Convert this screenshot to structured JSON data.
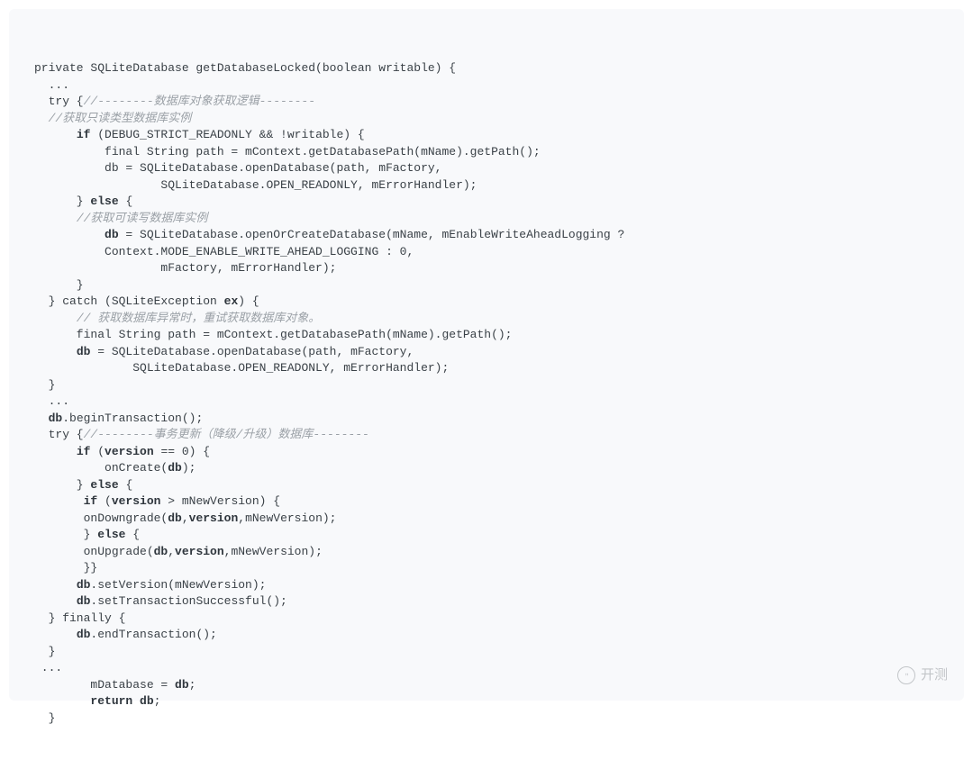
{
  "watermark": {
    "label": "开测"
  },
  "code": {
    "lines": [
      [
        {
          "t": "private SQLiteDatabase getDatabaseLocked(boolean writable) {",
          "c": "id"
        }
      ],
      [
        {
          "t": "  ...",
          "c": "id"
        }
      ],
      [
        {
          "t": "  try {",
          "c": "id"
        },
        {
          "t": "//--------数据库对象获取逻辑--------",
          "c": "cm"
        }
      ],
      [
        {
          "t": "  ",
          "c": "id"
        },
        {
          "t": "//获取只读类型数据库实例",
          "c": "cm"
        }
      ],
      [
        {
          "t": "      ",
          "c": "id"
        },
        {
          "t": "if",
          "c": "kw"
        },
        {
          "t": " (DEBUG_STRICT_READONLY && !writable) {",
          "c": "id"
        }
      ],
      [
        {
          "t": "          final String path = mContext.getDatabasePath(mName).getPath();",
          "c": "id"
        }
      ],
      [
        {
          "t": "          db = SQLiteDatabase.openDatabase(path, mFactory,",
          "c": "id"
        }
      ],
      [
        {
          "t": "                  SQLiteDatabase.OPEN_READONLY, mErrorHandler);",
          "c": "id"
        }
      ],
      [
        {
          "t": "      } ",
          "c": "id"
        },
        {
          "t": "else",
          "c": "kw"
        },
        {
          "t": " {",
          "c": "id"
        }
      ],
      [
        {
          "t": "      ",
          "c": "id"
        },
        {
          "t": "//获取可读写数据库实例",
          "c": "cm"
        }
      ],
      [
        {
          "t": "          ",
          "c": "id"
        },
        {
          "t": "db",
          "c": "kw"
        },
        {
          "t": " = SQLiteDatabase.openOrCreateDatabase(mName, mEnableWriteAheadLogging ?",
          "c": "id"
        }
      ],
      [
        {
          "t": "          Context.MODE_ENABLE_WRITE_AHEAD_LOGGING : 0,",
          "c": "id"
        }
      ],
      [
        {
          "t": "                  mFactory, mErrorHandler);",
          "c": "id"
        }
      ],
      [
        {
          "t": "      }",
          "c": "id"
        }
      ],
      [
        {
          "t": "  } catch (SQLiteException ",
          "c": "id"
        },
        {
          "t": "ex",
          "c": "kw"
        },
        {
          "t": ") {",
          "c": "id"
        }
      ],
      [
        {
          "t": "      ",
          "c": "id"
        },
        {
          "t": "// 获取数据库异常时，重试获取数据库对象。",
          "c": "cm"
        }
      ],
      [
        {
          "t": "      final String path = mContext.getDatabasePath(mName).getPath();",
          "c": "id"
        }
      ],
      [
        {
          "t": "      ",
          "c": "id"
        },
        {
          "t": "db",
          "c": "kw"
        },
        {
          "t": " = SQLiteDatabase.openDatabase(path, mFactory,",
          "c": "id"
        }
      ],
      [
        {
          "t": "              SQLiteDatabase.OPEN_READONLY, mErrorHandler);",
          "c": "id"
        }
      ],
      [
        {
          "t": "  }",
          "c": "id"
        }
      ],
      [
        {
          "t": "  ...",
          "c": "id"
        }
      ],
      [
        {
          "t": "  ",
          "c": "id"
        },
        {
          "t": "db",
          "c": "kw"
        },
        {
          "t": ".beginTransaction();",
          "c": "id"
        }
      ],
      [
        {
          "t": "  try {",
          "c": "id"
        },
        {
          "t": "//--------事务更新（降级/升级）数据库--------",
          "c": "cm"
        }
      ],
      [
        {
          "t": "      ",
          "c": "id"
        },
        {
          "t": "if",
          "c": "kw"
        },
        {
          "t": " (",
          "c": "id"
        },
        {
          "t": "version",
          "c": "kw"
        },
        {
          "t": " == 0) {",
          "c": "id"
        }
      ],
      [
        {
          "t": "          onCreate(",
          "c": "id"
        },
        {
          "t": "db",
          "c": "kw"
        },
        {
          "t": ");",
          "c": "id"
        }
      ],
      [
        {
          "t": "      } ",
          "c": "id"
        },
        {
          "t": "else",
          "c": "kw"
        },
        {
          "t": " {",
          "c": "id"
        }
      ],
      [
        {
          "t": "       ",
          "c": "id"
        },
        {
          "t": "if",
          "c": "kw"
        },
        {
          "t": " (",
          "c": "id"
        },
        {
          "t": "version",
          "c": "kw"
        },
        {
          "t": " > mNewVersion) {",
          "c": "id"
        }
      ],
      [
        {
          "t": "       onDowngrade(",
          "c": "id"
        },
        {
          "t": "db",
          "c": "kw"
        },
        {
          "t": ",",
          "c": "id"
        },
        {
          "t": "version",
          "c": "kw"
        },
        {
          "t": ",mNewVersion);",
          "c": "id"
        }
      ],
      [
        {
          "t": "       } ",
          "c": "id"
        },
        {
          "t": "else",
          "c": "kw"
        },
        {
          "t": " {",
          "c": "id"
        }
      ],
      [
        {
          "t": "       onUpgrade(",
          "c": "id"
        },
        {
          "t": "db",
          "c": "kw"
        },
        {
          "t": ",",
          "c": "id"
        },
        {
          "t": "version",
          "c": "kw"
        },
        {
          "t": ",mNewVersion);",
          "c": "id"
        }
      ],
      [
        {
          "t": "       }}",
          "c": "id"
        }
      ],
      [
        {
          "t": "      ",
          "c": "id"
        },
        {
          "t": "db",
          "c": "kw"
        },
        {
          "t": ".setVersion(mNewVersion);",
          "c": "id"
        }
      ],
      [
        {
          "t": "      ",
          "c": "id"
        },
        {
          "t": "db",
          "c": "kw"
        },
        {
          "t": ".setTransactionSuccessful();",
          "c": "id"
        }
      ],
      [
        {
          "t": "  } finally {",
          "c": "id"
        }
      ],
      [
        {
          "t": "      ",
          "c": "id"
        },
        {
          "t": "db",
          "c": "kw"
        },
        {
          "t": ".endTransaction();",
          "c": "id"
        }
      ],
      [
        {
          "t": "  }",
          "c": "id"
        }
      ],
      [
        {
          "t": " ...",
          "c": "id"
        }
      ],
      [
        {
          "t": "        mDatabase = ",
          "c": "id"
        },
        {
          "t": "db",
          "c": "kw"
        },
        {
          "t": ";",
          "c": "id"
        }
      ],
      [
        {
          "t": "        ",
          "c": "id"
        },
        {
          "t": "return db",
          "c": "kw"
        },
        {
          "t": ";",
          "c": "id"
        }
      ],
      [
        {
          "t": "  }",
          "c": "id"
        }
      ]
    ]
  }
}
